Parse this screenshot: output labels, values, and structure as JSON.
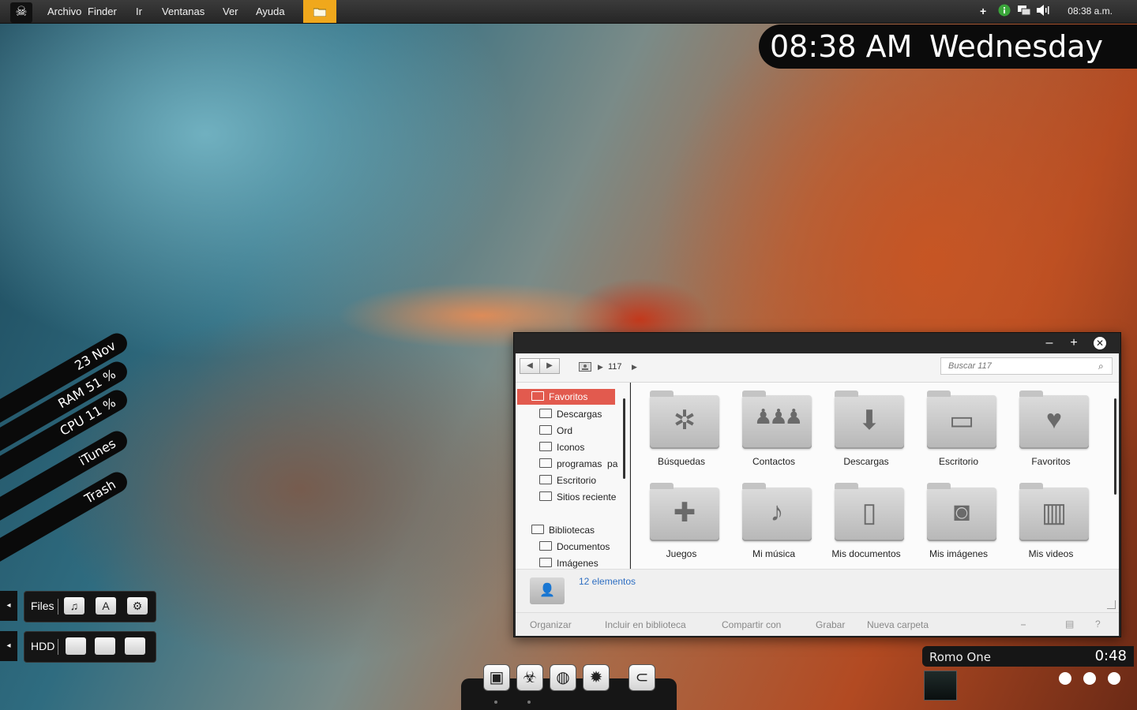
{
  "menubar": {
    "items": [
      "Archivo",
      "Finder",
      "Ir",
      "Ventanas",
      "Ver",
      "Ayuda"
    ],
    "clock": "08:38 a.m.",
    "logo_icon": "skull-icon",
    "tray_icons": [
      "plus-icon",
      "info-icon",
      "display-icon",
      "volume-icon"
    ]
  },
  "bigclock": {
    "time": "08:38 AM",
    "day": "Wednesday"
  },
  "stats": [
    "23 Nov",
    "RAM 51 %",
    "CPU 11 %",
    "iTunes",
    "Trash"
  ],
  "leftpanels": {
    "files_label": "Files",
    "files_icons": [
      "music-note-icon",
      "app-store-icon",
      "gear-icon"
    ],
    "hdd_label": "HDD",
    "side_arrow": "◂"
  },
  "explorer": {
    "breadcrumb": "117",
    "search_placeholder": "Buscar 117",
    "sidebar": [
      "Favoritos",
      "Descargas",
      "Ord",
      "Iconos",
      "programas  pa",
      "Escritorio",
      "Sitios reciente",
      "Bibliotecas",
      "Documentos",
      "Imágenes"
    ],
    "items": [
      "Búsquedas",
      "Contactos",
      "Descargas",
      "Escritorio",
      "Favoritos",
      "Juegos",
      "Mi música",
      "Mis documentos",
      "Mis imágenes",
      "Mis videos"
    ],
    "item_icons": [
      "compass-icon",
      "people-icon",
      "download-icon",
      "desktop-window-icon",
      "heart-icon",
      "gamepad-icon",
      "music-note-icon",
      "document-icon",
      "camera-icon",
      "film-icon"
    ],
    "count": "12 elementos",
    "commands": [
      "Organizar",
      "Incluir en biblioteca",
      "Compartir con",
      "Grabar",
      "Nueva carpeta"
    ]
  },
  "dock": {
    "icons": [
      "monitor-icon",
      "biohazard-icon",
      "globe-icon",
      "bug-icon",
      "paperclip-icon"
    ]
  },
  "media": {
    "song": "Romo One",
    "time": "0:48"
  },
  "colors": {
    "accent": "#f0a81c",
    "selection": "#e25a4e",
    "link": "#2f6fc2"
  }
}
